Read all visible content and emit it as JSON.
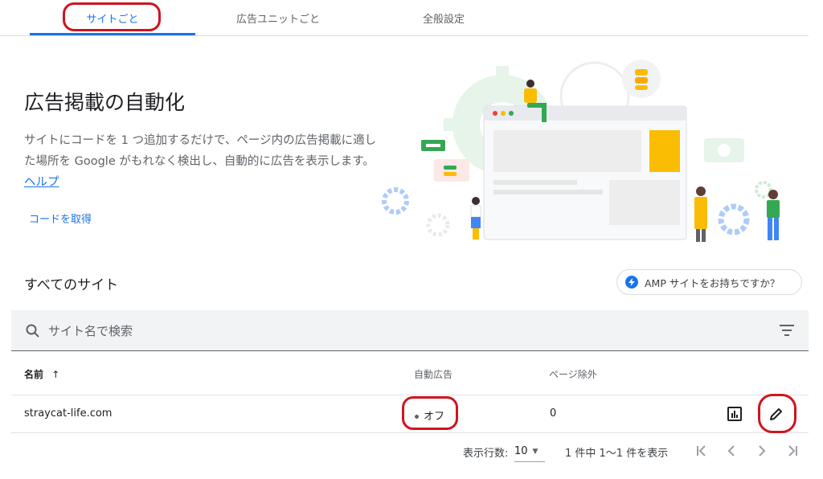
{
  "tabs": [
    {
      "label": "サイトごと",
      "active": true
    },
    {
      "label": "広告ユニットごと",
      "active": false
    },
    {
      "label": "全般設定",
      "active": false
    }
  ],
  "hero": {
    "title": "広告掲載の自動化",
    "description": "サイトにコードを 1 つ追加するだけで、ページ内の広告掲載に適した場所を Google がもれなく検出し、自動的に広告を表示します。",
    "help_link": "ヘルプ",
    "get_code": "コードを取得"
  },
  "section": {
    "title": "すべてのサイト",
    "amp_chip": "AMP サイトをお持ちですか？"
  },
  "search": {
    "placeholder": "サイト名で検索"
  },
  "table": {
    "headers": {
      "name": "名前",
      "auto_ads": "自動広告",
      "page_exclusions": "ページ除外"
    },
    "rows": [
      {
        "site": "straycat-life.com",
        "auto_ads": "オフ",
        "page_exclusions": "0"
      }
    ]
  },
  "pagination": {
    "rows_label": "表示行数:",
    "rows_value": "10",
    "range": "1 件中 1～1 件を表示"
  },
  "colors": {
    "accent": "#1a73e8",
    "highlight_ring": "#d0141e"
  },
  "icons": [
    "search-icon",
    "filter-icon",
    "sort-arrow-up-icon",
    "report-chart-icon",
    "edit-pencil-icon",
    "bolt-icon",
    "first-page-icon",
    "prev-page-icon",
    "next-page-icon",
    "last-page-icon"
  ]
}
